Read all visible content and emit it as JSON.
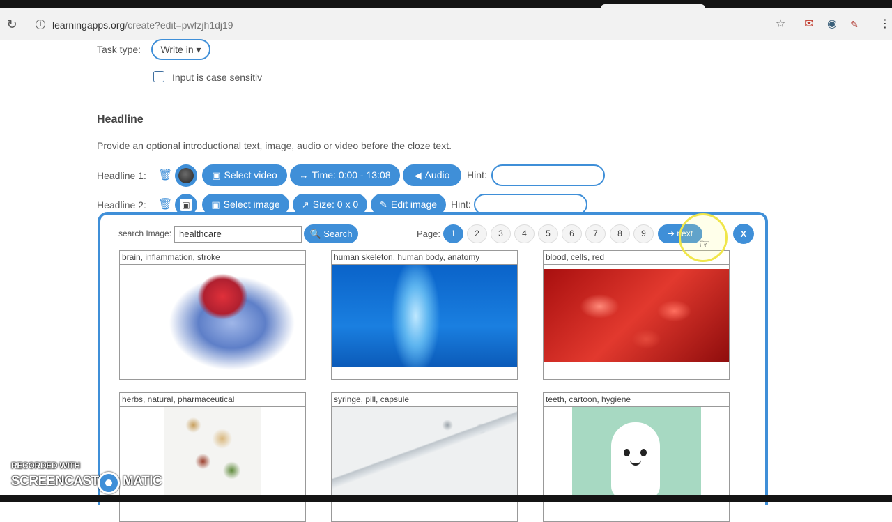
{
  "browser": {
    "url_host": "learningapps.org",
    "url_path": "/create?edit=pwfzjh1dj19"
  },
  "task": {
    "type_label": "Task type:",
    "type_value": "Write in",
    "case_label": "Input is case sensitiv"
  },
  "headline": {
    "title": "Headline",
    "description": "Provide an optional introductional text, image, audio or video before the cloze text.",
    "row1": {
      "label": "Headline 1:",
      "select_video": "Select video",
      "time": "Time: 0:00 - 13:08",
      "audio": "Audio",
      "hint_label": "Hint:"
    },
    "row2": {
      "label": "Headline 2:",
      "select_image": "Select image",
      "size": "Size: 0 x 0",
      "edit_image": "Edit image",
      "hint_label": "Hint:"
    }
  },
  "image_search": {
    "search_label": "search Image:",
    "query": "healthcare",
    "search_button": "Search",
    "page_label": "Page:",
    "pages": [
      "1",
      "2",
      "3",
      "4",
      "5",
      "6",
      "7",
      "8",
      "9"
    ],
    "active_page": "1",
    "next_button": "next",
    "close_button": "X",
    "results": [
      {
        "tags": "brain, inflammation, stroke"
      },
      {
        "tags": "human skeleton, human body, anatomy"
      },
      {
        "tags": "blood, cells, red"
      },
      {
        "tags": "herbs, natural, pharmaceutical"
      },
      {
        "tags": "syringe, pill, capsule"
      },
      {
        "tags": "teeth, cartoon, hygiene"
      }
    ]
  },
  "watermark": {
    "line1": "RECORDED WITH",
    "line2a": "SCREENCAST",
    "line2b": "MATIC"
  },
  "colors": {
    "accent": "#3f8fd8"
  }
}
